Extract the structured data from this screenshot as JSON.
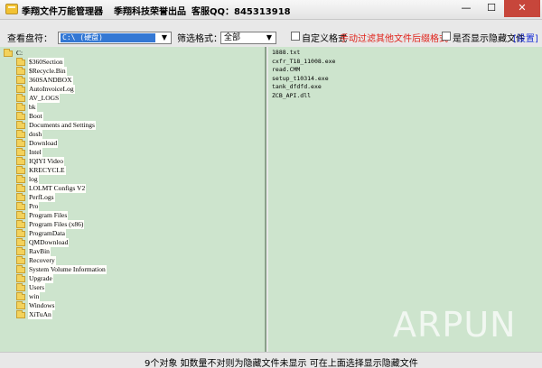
{
  "titlebar": {
    "title": "季翔文件万能管理器",
    "brand": "季翔科技荣誉出品",
    "service": "客服QQ：845313918",
    "min": "—",
    "max": "☐",
    "close": "✕"
  },
  "toolbar": {
    "drive_label": "查看盘符：",
    "drive_value": "C:\\ (硬盘)",
    "filter_label": "筛选格式：",
    "filter_value": "全部",
    "custom_format_label": "自定义格式",
    "filter_hint": "手动过滤其他文件后缀格式",
    "show_hidden_label": "是否显示隐藏文件",
    "settings_link": "[设置]"
  },
  "tree": {
    "root": "C:",
    "folders": [
      "$360Section",
      "$Recycle.Bin",
      "360SANDBOX",
      "AutoInvoiceLog",
      "AV_LOGS",
      "bk",
      "Boot",
      "Documents and Settings",
      "dosh",
      "Download",
      "Intel",
      "IQIYI Video",
      "KRECYCLE",
      "log",
      "LOLMT Configs V2",
      "PerfLogs",
      "Pro",
      "Program Files",
      "Program Files (x86)",
      "ProgramData",
      "QMDownload",
      "RavBin",
      "Recovery",
      "System Volume Information",
      "Upgrade",
      "Users",
      "win",
      "Windows",
      "XiTuAn"
    ]
  },
  "files": [
    "1888.txt",
    "cxfr_T18_11008.exe",
    "read.CMM",
    "setup_t10314.exe",
    "tank_dfdfd.exe",
    "ZCB_API.dll"
  ],
  "watermark": "ARPUN",
  "status": "9个对象    如数量不对则为隐藏文件未显示    可在上面选择显示隐藏文件"
}
